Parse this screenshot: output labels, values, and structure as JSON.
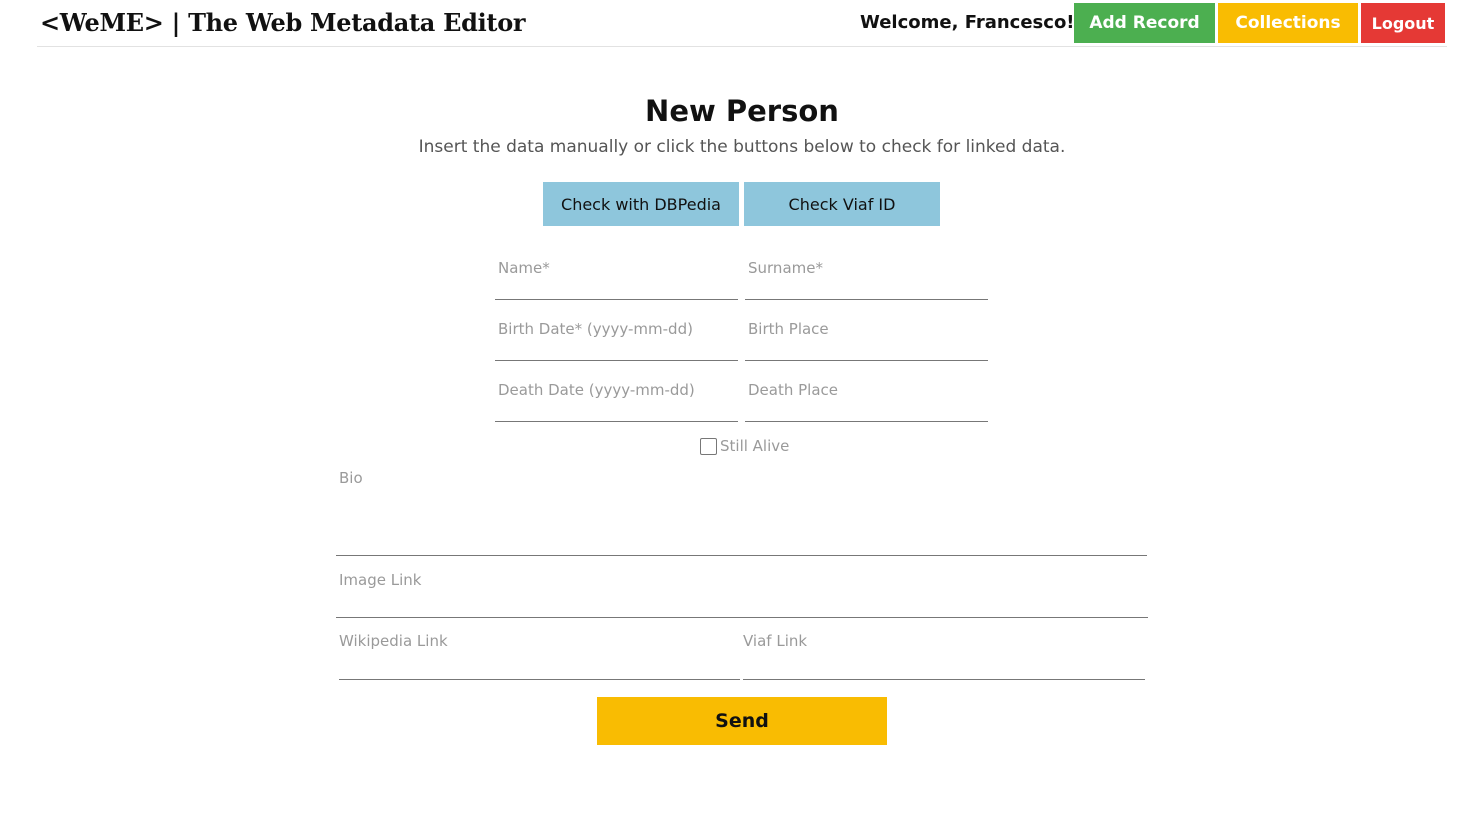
{
  "header": {
    "brand": "<WeME> | The Web Metadata Editor",
    "welcome": "Welcome, Francesco!",
    "nav": {
      "add_record": "Add Record",
      "collections": "Collections",
      "logout": "Logout"
    }
  },
  "main": {
    "title": "New Person",
    "subtitle": "Insert the data manually or click the buttons below to check for linked data.",
    "lookup": {
      "dbpedia": "Check with DBPedia",
      "viaf": "Check Viaf ID"
    },
    "fields": {
      "name": {
        "label": "Name*",
        "value": ""
      },
      "surname": {
        "label": "Surname*",
        "value": ""
      },
      "birth_date": {
        "label": "Birth Date* (yyyy-mm-dd)",
        "value": ""
      },
      "birth_place": {
        "label": "Birth Place",
        "value": ""
      },
      "death_date": {
        "label": "Death Date (yyyy-mm-dd)",
        "value": ""
      },
      "death_place": {
        "label": "Death Place",
        "value": ""
      },
      "bio": {
        "label": "Bio",
        "value": ""
      },
      "image_link": {
        "label": "Image Link",
        "value": ""
      },
      "wikipedia_link": {
        "label": "Wikipedia Link",
        "value": ""
      },
      "viaf_link": {
        "label": "Viaf Link",
        "value": ""
      }
    },
    "still_alive": {
      "label": "Still Alive",
      "checked": false
    },
    "send": "Send"
  },
  "colors": {
    "add_record": "#4caf50",
    "collections": "#f9bc02",
    "logout": "#e53935",
    "lookup_button": "#8ec6dc",
    "send_button": "#f9bc02"
  },
  "icons": {
    "checkbox": "checkbox-unchecked-icon"
  }
}
